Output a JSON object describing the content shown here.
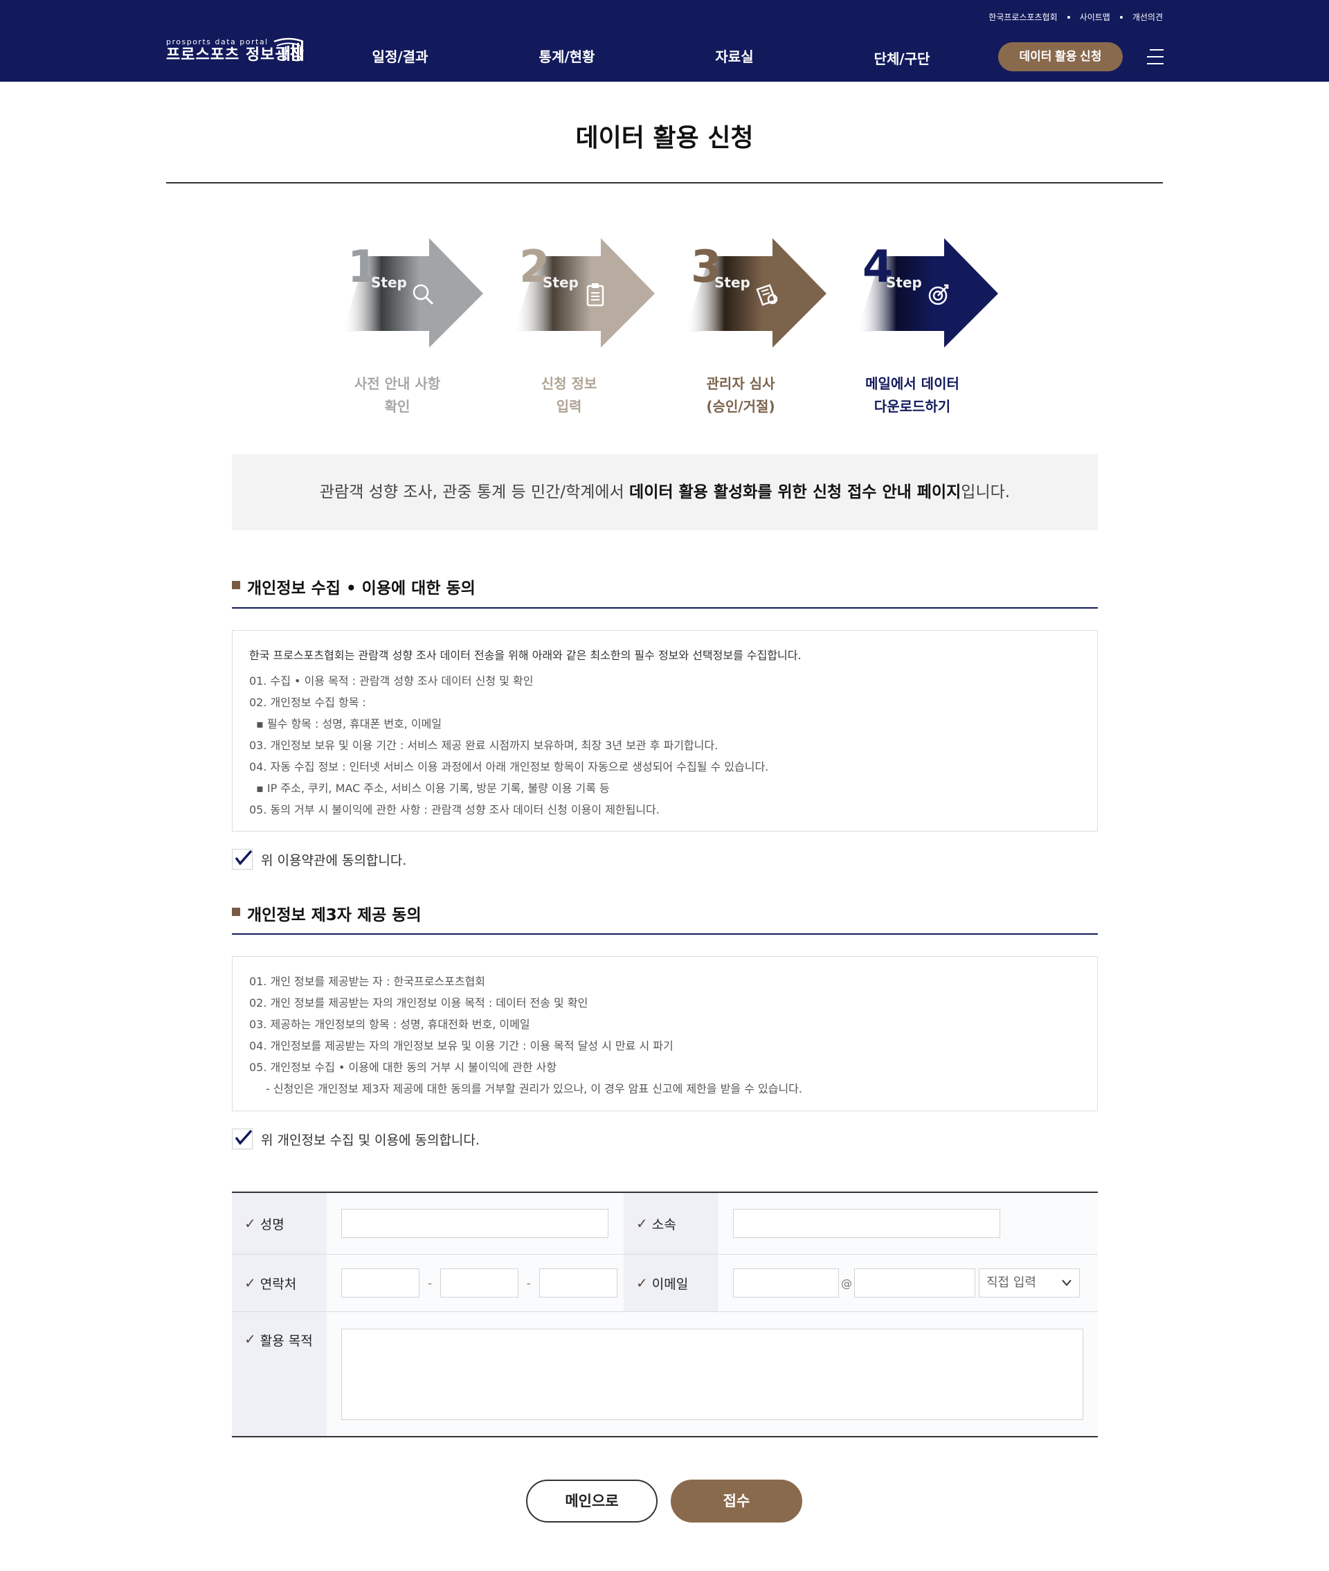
{
  "header": {
    "util_links": [
      "한국프로스포츠협회",
      "사이트맵",
      "개선의견"
    ],
    "logo_small": "prosports data portal",
    "logo_title": "프로스포츠 정보광장",
    "nav": [
      "일정/결과",
      "통계/현황",
      "자료실",
      "단체/구단"
    ],
    "apply_button": "데이터 활용 신청"
  },
  "page_title": "데이터 활용 신청",
  "steps": [
    {
      "num": "1",
      "label": "Step",
      "caption": [
        "사전 안내 사항",
        "확인"
      ],
      "icon": "search-icon",
      "color": "#a1a5a8",
      "num_color": "#9a9ea1",
      "caption_color": "#a7a7a7"
    },
    {
      "num": "2",
      "label": "Step",
      "caption": [
        "신청 정보",
        "입력"
      ],
      "icon": "clipboard-icon",
      "color": "#b8aca0",
      "num_color": "#b0a394",
      "caption_color": "#b0a394"
    },
    {
      "num": "3",
      "label": "Step",
      "caption": [
        "관리자 심사",
        "(승인/거절)"
      ],
      "icon": "document-review-icon",
      "color": "#7c634c",
      "num_color": "#7c634c",
      "caption_color": "#7c634c"
    },
    {
      "num": "4",
      "label": "Step",
      "caption": [
        "메일에서 데이터",
        "다운로드하기"
      ],
      "icon": "target-icon",
      "color": "#121a5c",
      "num_color": "#121a5c",
      "caption_color": "#121a5c"
    }
  ],
  "info": {
    "prefix": "관람객 성향 조사, 관중 통계 등 민간/학계에서 ",
    "bold": "데이터 활용 활성화를 위한 신청 접수 안내 페이지",
    "suffix": "입니다."
  },
  "section1": {
    "title": "개인정보 수집 • 이용에 대한 동의",
    "lines": [
      "한국 프로스포츠협회는 관람객 성향 조사 데이터 전송을 위해 아래와 같은 최소한의 필수 정보와 선택정보를 수집합니다.",
      "01. 수집 • 이용 목적 : 관람객 성향 조사 데이터 신청 및 확인",
      "02. 개인정보 수집 항목 :",
      "▪ 필수 항목 : 성명, 휴대폰 번호, 이메일",
      "03. 개인정보 보유 및 이용 기간 : 서비스 제공 완료 시점까지 보유하며, 최장 3년 보관 후 파기합니다.",
      "04. 자동 수집 정보 : 인터넷 서비스 이용 과정에서 아래 개인정보 항목이 자동으로 생성되어 수집될 수 있습니다.",
      "▪ IP 주소, 쿠키, MAC 주소, 서비스 이용 기록, 방문 기록, 불량 이용 기록 등",
      "05. 동의 거부 시 불이익에 관한 사항 : 관람객 성향 조사 데이터 신청 이용이 제한됩니다."
    ],
    "agree": "위 이용약관에 동의합니다."
  },
  "section2": {
    "title": "개인정보 제3자 제공 동의",
    "lines": [
      "01. 개인 정보를 제공받는 자 : 한국프로스포츠협회",
      "02. 개인 정보를 제공받는 자의 개인정보 이용 목적 : 데이터 전송 및 확인",
      "03. 제공하는 개인정보의 항목 : 성명, 휴대전화 번호, 이메일",
      "04. 개인정보를 제공받는 자의 개인정보 보유 및 이용 기간 : 이용 목적 달성 시 만료 시 파기",
      "05. 개인정보 수집 • 이용에 대한 동의 거부 시 불이익에 관한 사항",
      "- 신청인은 개인정보 제3자 제공에 대한 동의를 거부할 권리가 있으나, 이 경우 암표 신고에 제한을 받을 수 있습니다."
    ],
    "agree": "위 개인정보 수집 및 이용에 동의합니다."
  },
  "form": {
    "check": "✓",
    "name_label": "성명",
    "org_label": "소속",
    "phone_label": "연락처",
    "phone_sep": "-",
    "email_label": "이메일",
    "email_at": "@",
    "email_domain_select": "직접 입력",
    "purpose_label": "활용 목적"
  },
  "buttons": {
    "main": "메인으로",
    "submit": "접수"
  }
}
